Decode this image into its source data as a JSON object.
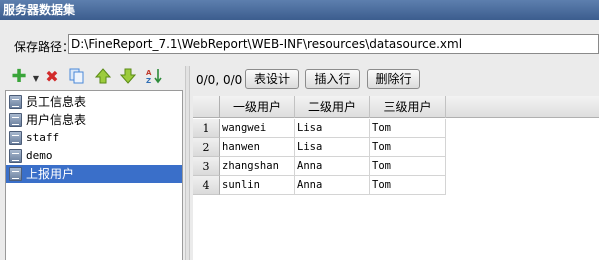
{
  "window": {
    "title": "服务器数据集"
  },
  "path": {
    "label": "保存路径：",
    "value": "D:\\FineReport_7.1\\WebReport\\WEB-INF\\resources\\datasource.xml"
  },
  "toolbar": {
    "icons": [
      "add-icon",
      "delete-icon",
      "copy-icon",
      "move-up-icon",
      "move-down-icon",
      "sort-icon"
    ],
    "colors": {
      "add": "#3aa53a",
      "delete": "#d22b2b",
      "copy": "#4a88d8",
      "arrows": "#8bc34a",
      "sort": "#c0392b"
    }
  },
  "datasets": [
    {
      "label": "员工信息表",
      "selected": false
    },
    {
      "label": "用户信息表",
      "selected": false
    },
    {
      "label": "staff",
      "selected": false
    },
    {
      "label": "demo",
      "selected": false
    },
    {
      "label": "上报用户",
      "selected": true
    }
  ],
  "editor": {
    "rows_info": "0/0, 0/0",
    "buttons": {
      "design": "表设计",
      "insert_row": "插入行",
      "delete_row": "删除行"
    }
  },
  "table": {
    "columns": [
      "一级用户",
      "二级用户",
      "三级用户"
    ],
    "rows": [
      {
        "num": "1",
        "cells": [
          "wangwei",
          "Lisa",
          "Tom"
        ]
      },
      {
        "num": "2",
        "cells": [
          "hanwen",
          "Lisa",
          "Tom"
        ]
      },
      {
        "num": "3",
        "cells": [
          "zhangshan",
          "Anna",
          "Tom"
        ]
      },
      {
        "num": "4",
        "cells": [
          "sunlin",
          "Anna",
          "Tom"
        ]
      }
    ]
  },
  "colors": {
    "title_bar": "#4a6c9e",
    "selection": "#3a6fc9"
  }
}
